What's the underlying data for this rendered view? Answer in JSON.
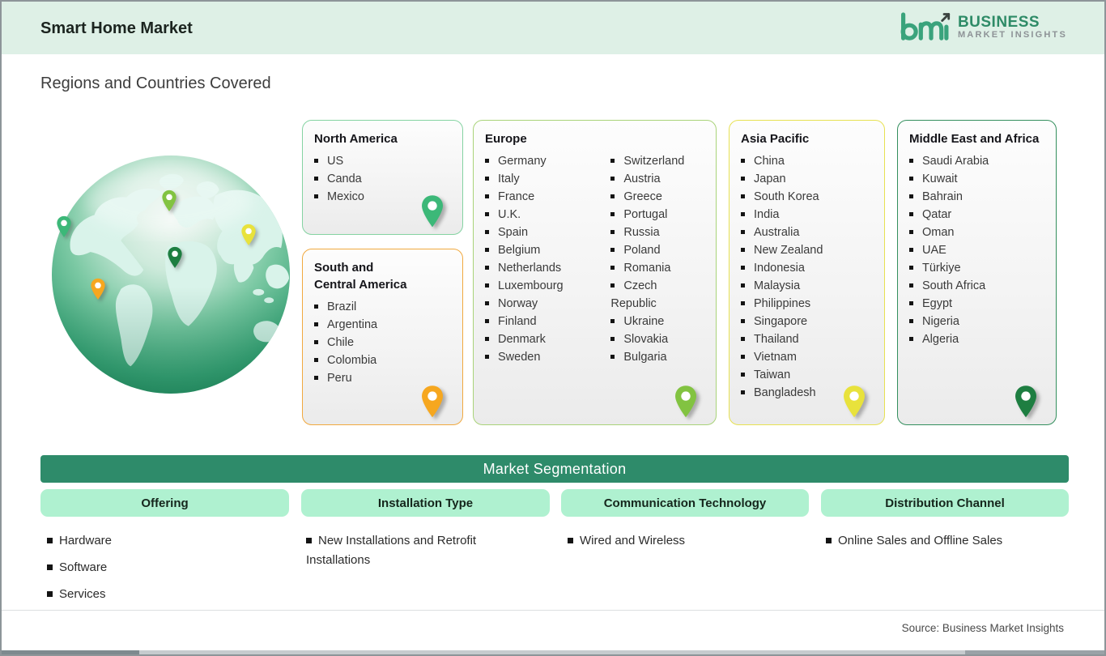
{
  "header": {
    "title": "Smart Home Market",
    "logo": {
      "mark": "bmi",
      "name_line1": "BUSINESS",
      "name_line2": "MARKET INSIGHTS"
    }
  },
  "page": {
    "section_title": "Regions and Countries Covered",
    "source_note": "Source: Business Market Insights"
  },
  "theme": {
    "header_bg": "#def0e6",
    "brand_green": "#2e8b67",
    "logo_gray": "#8d9296",
    "pill_bg": "#aff1d0",
    "seg_bar_bg": "#2e8b6a"
  },
  "regions": {
    "north_america": {
      "title": "North America",
      "countries": [
        "US",
        "Canda",
        "Mexico"
      ],
      "border_color": "#85d3a2",
      "pin_color": "#3cb878"
    },
    "south_central_america": {
      "title": "South and\nCentral America",
      "countries": [
        "Brazil",
        "Argentina",
        "Chile",
        "Colombia",
        "Peru"
      ],
      "border_color": "#f1a93f",
      "pin_color": "#f6a71f"
    },
    "europe": {
      "title": "Europe",
      "countries_col1": [
        "Germany",
        "Italy",
        "France",
        "U.K.",
        "Spain",
        "Belgium",
        "Netherlands",
        "Luxembourg",
        "Norway",
        "Finland",
        "Denmark",
        "Sweden"
      ],
      "countries_col2": [
        "Switzerland",
        "Austria",
        "Greece",
        "Portugal",
        "Russia",
        "Poland",
        "Romania",
        "Czech Republic",
        "Ukraine",
        "Slovakia",
        "Bulgaria"
      ],
      "border_color": "#a9d379",
      "pin_color": "#82c341"
    },
    "asia_pacific": {
      "title": "Asia Pacific",
      "countries": [
        "China",
        "Japan",
        "South Korea",
        "India",
        "Australia",
        "New Zealand",
        "Indonesia",
        "Malaysia",
        "Philippines",
        "Singapore",
        "Thailand",
        "Vietnam",
        "Taiwan",
        "Bangladesh"
      ],
      "border_color": "#e7e152",
      "pin_color": "#e8e23c"
    },
    "middle_east_africa": {
      "title": "Middle East and Africa",
      "countries": [
        "Saudi Arabia",
        "Kuwait",
        "Bahrain",
        "Qatar",
        "Oman",
        "UAE",
        "Türkiye",
        "South Africa",
        "Egypt",
        "Nigeria",
        "Algeria"
      ],
      "border_color": "#338f5d",
      "pin_color": "#1e7e41"
    }
  },
  "segmentation": {
    "title": "Market Segmentation",
    "columns": [
      {
        "label": "Offering",
        "items": [
          "Hardware",
          "Software",
          "Services"
        ]
      },
      {
        "label": "Installation Type",
        "items": [
          "New Installations and Retrofit Installations"
        ]
      },
      {
        "label": "Communication Technology",
        "items": [
          "Wired and Wireless"
        ]
      },
      {
        "label": "Distribution Channel",
        "items": [
          "Online Sales and Offline Sales"
        ]
      }
    ]
  }
}
